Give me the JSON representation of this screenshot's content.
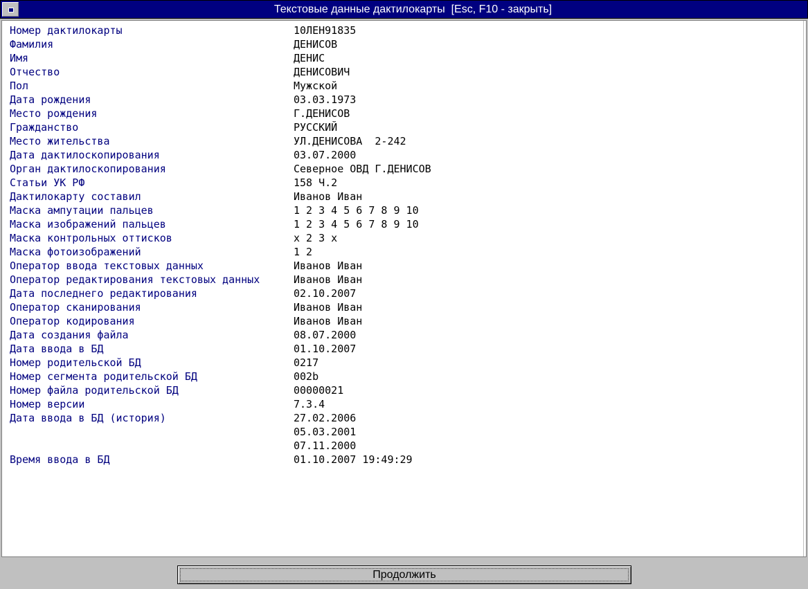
{
  "window": {
    "title": "Текстовые данные дактилокарты  [Esc, F10 - закрыть]"
  },
  "fields": [
    {
      "label": "Номер дактилокарты",
      "value": "10ЛЕН91835"
    },
    {
      "label": "Фамилия",
      "value": "ДЕНИСОВ"
    },
    {
      "label": "Имя",
      "value": "ДЕНИС"
    },
    {
      "label": "Отчество",
      "value": "ДЕНИСОВИЧ"
    },
    {
      "label": "Пол",
      "value": "Мужской"
    },
    {
      "label": "Дата рождения",
      "value": "03.03.1973"
    },
    {
      "label": "Место рождения",
      "value": "Г.ДЕНИСОВ"
    },
    {
      "label": "Гражданство",
      "value": "РУССКИЙ"
    },
    {
      "label": "Место жительства",
      "value": "УЛ.ДЕНИСОВА  2-242"
    },
    {
      "label": "Дата дактилоскопирования",
      "value": "03.07.2000"
    },
    {
      "label": "Орган дактилоскопирования",
      "value": "Северное ОВД Г.ДЕНИСОВ"
    },
    {
      "label": "Статьи УК РФ",
      "value": "158 Ч.2"
    },
    {
      "label": "Дактилокарту составил",
      "value": "Иванов Иван"
    },
    {
      "label": "Маска ампутации пальцев",
      "value": "1 2 3 4 5 6 7 8 9 10"
    },
    {
      "label": "Маска изображений пальцев",
      "value": "1 2 3 4 5 6 7 8 9 10"
    },
    {
      "label": "Маска контрольных оттисков",
      "value": "x 2 3 x"
    },
    {
      "label": "Маска фотоизображений",
      "value": "1 2"
    },
    {
      "label": "Оператор ввода текстовых данных",
      "value": "Иванов Иван"
    },
    {
      "label": "Оператор редактирования текстовых данных",
      "value": "Иванов Иван"
    },
    {
      "label": "Дата последнего редактирования",
      "value": "02.10.2007"
    },
    {
      "label": "Оператор сканирования",
      "value": "Иванов Иван"
    },
    {
      "label": "Оператор кодирования",
      "value": "Иванов Иван"
    },
    {
      "label": "Дата создания файла",
      "value": "08.07.2000"
    },
    {
      "label": "Дата ввода в БД",
      "value": "01.10.2007"
    },
    {
      "label": "Номер родительской БД",
      "value": "0217"
    },
    {
      "label": "Номер сегмента родительской БД",
      "value": "002b"
    },
    {
      "label": "Номер файла родительской БД",
      "value": "00000021"
    },
    {
      "label": "Номер версии",
      "value": "7.3.4"
    },
    {
      "label": "Дата ввода в БД (история)",
      "value": "27.02.2006"
    },
    {
      "label": "",
      "value": "05.03.2001"
    },
    {
      "label": "",
      "value": "07.11.2000"
    },
    {
      "label": "Время ввода в БД",
      "value": "01.10.2007 19:49:29"
    }
  ],
  "footer": {
    "continue_label": "Продолжить"
  },
  "colors": {
    "titlebar": "#000080",
    "label_text": "#00007f",
    "value_text": "#000000",
    "face": "#c0c0c0"
  }
}
